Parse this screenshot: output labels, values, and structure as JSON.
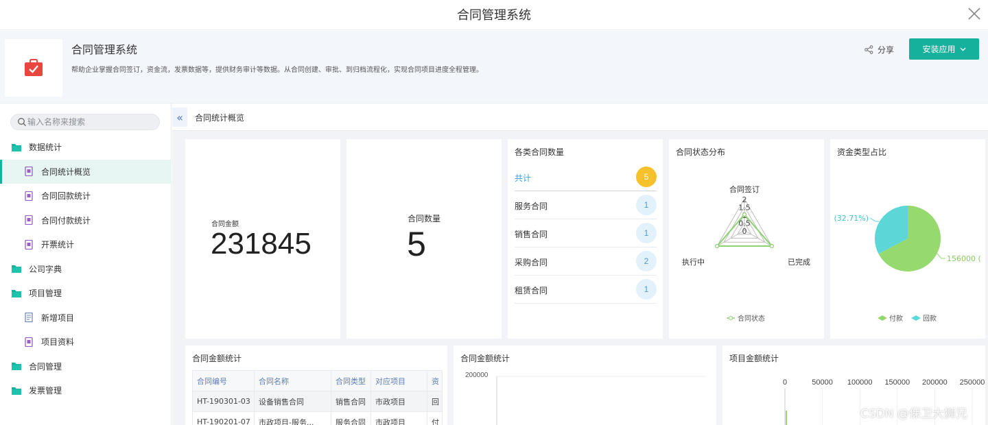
{
  "window": {
    "title": "合同管理系统"
  },
  "app": {
    "name": "合同管理系统",
    "description": "帮助企业掌握合同签订，资金流，发票数据等，提供财务审计等数据。从合同创建、审批、到归档流程化，实现合同项目进度全程管理。",
    "share_label": "分享",
    "install_label": "安装应用",
    "accent": "#16b19d"
  },
  "sidebar": {
    "search_placeholder": "输入名称来搜索",
    "items": [
      {
        "label": "数据统计",
        "level": "group",
        "icon": "folder-icon"
      },
      {
        "label": "合同统计概览",
        "level": "sub",
        "icon": "report-icon",
        "active": true
      },
      {
        "label": "合同回款统计",
        "level": "sub",
        "icon": "report-icon"
      },
      {
        "label": "合同付款统计",
        "level": "sub",
        "icon": "report-icon"
      },
      {
        "label": "开票统计",
        "level": "sub",
        "icon": "report-icon"
      },
      {
        "label": "公司字典",
        "level": "group",
        "icon": "folder-icon"
      },
      {
        "label": "项目管理",
        "level": "group",
        "icon": "folder-icon"
      },
      {
        "label": "新增项目",
        "level": "sub",
        "icon": "form-icon"
      },
      {
        "label": "项目资料",
        "level": "sub",
        "icon": "report-icon"
      },
      {
        "label": "合同管理",
        "level": "group",
        "icon": "folder-icon"
      },
      {
        "label": "发票管理",
        "level": "group",
        "icon": "folder-icon"
      }
    ]
  },
  "breadcrumb": {
    "collapse_glyph": "«",
    "current": "合同统计概览"
  },
  "kpis": {
    "amount": {
      "label": "合同金额",
      "value": "231845"
    },
    "count": {
      "label": "合同数量",
      "value": "5"
    }
  },
  "contract_counts": {
    "title": "各类合同数量",
    "rows": [
      {
        "label": "共计",
        "value": "5",
        "total": true
      },
      {
        "label": "服务合同",
        "value": "1"
      },
      {
        "label": "销售合同",
        "value": "1"
      },
      {
        "label": "采购合同",
        "value": "2"
      },
      {
        "label": "租赁合同",
        "value": "1"
      }
    ]
  },
  "status_chart": {
    "title": "合同状态分布",
    "indicators": [
      "合同签订",
      "已完成",
      "执行中"
    ],
    "ticks": [
      "2",
      "1.5",
      "1",
      "0.5",
      "0"
    ],
    "values": [
      1,
      2,
      2
    ],
    "max": 2,
    "legend": "合同状态",
    "color": "#8bd36e"
  },
  "fund_chart": {
    "title": "资金类型占比",
    "left_label": "(32.71%)",
    "right_label": "156000 (",
    "slices": [
      {
        "name": "付款",
        "value": 156000,
        "color": "#96d96f"
      },
      {
        "name": "回款",
        "value": 75845,
        "color": "#5dd6d8"
      }
    ]
  },
  "amount_table": {
    "title": "合同金额统计",
    "columns": [
      "合同编号",
      "合同名称",
      "合同类型",
      "对应项目",
      "资"
    ],
    "rows": [
      [
        "HT-190301-03",
        "设备销售合同",
        "销售合同",
        "市政项目",
        "回"
      ],
      [
        "HT-190201-07",
        "市政项目-服务...",
        "服务合同",
        "市政项目",
        "付"
      ]
    ]
  },
  "amount_chart": {
    "title": "合同金额统计",
    "y_top_tick": "200000"
  },
  "project_chart": {
    "title": "项目金额统计",
    "x_ticks": [
      "0",
      "50000",
      "100000",
      "150000",
      "200000",
      "250000"
    ]
  },
  "watermark": "CSDN @保卫大狮兄"
}
